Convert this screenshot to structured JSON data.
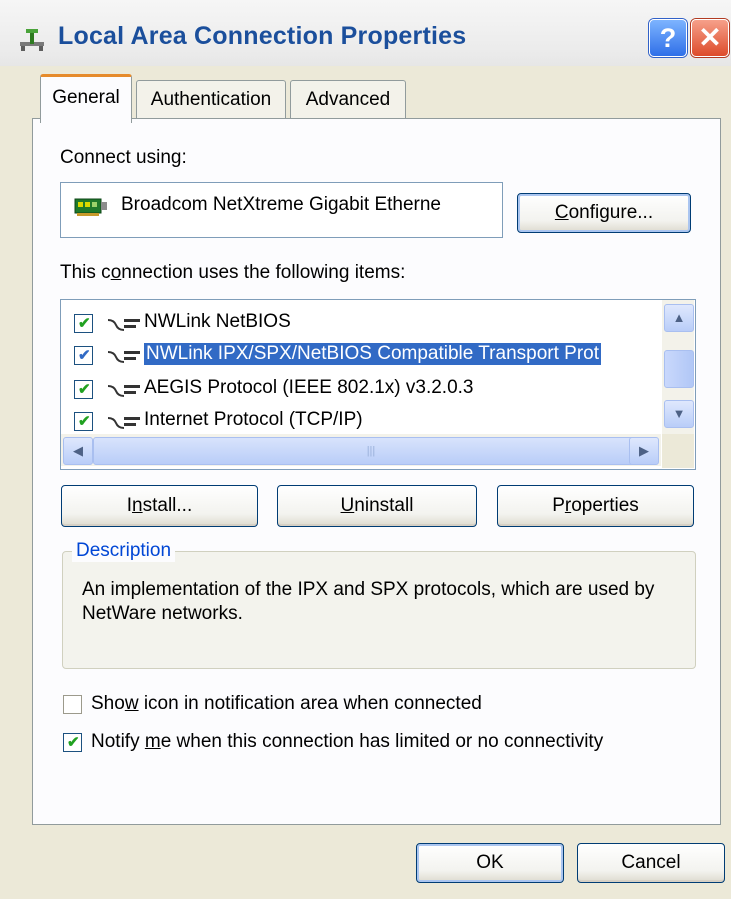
{
  "window": {
    "title": "Local Area Connection Properties",
    "help_glyph": "?",
    "close_glyph": "✕"
  },
  "tabs": [
    {
      "label": "General",
      "active": true
    },
    {
      "label": "Authentication",
      "active": false
    },
    {
      "label": "Advanced",
      "active": false
    }
  ],
  "general": {
    "connect_using_label": "Connect using:",
    "adapter_name": "Broadcom NetXtreme Gigabit Etherne",
    "configure_button": {
      "pre": "",
      "accel": "C",
      "post": "onfigure..."
    },
    "items_label": {
      "pre": "This c",
      "accel": "o",
      "post": "nnection uses the following items:"
    },
    "items": [
      {
        "label": "NWLink NetBIOS",
        "checked": true,
        "selected": false
      },
      {
        "label": "NWLink IPX/SPX/NetBIOS Compatible Transport Prot",
        "checked": true,
        "selected": true
      },
      {
        "label": "AEGIS Protocol (IEEE 802.1x) v3.2.0.3",
        "checked": true,
        "selected": false
      },
      {
        "label": "Internet Protocol (TCP/IP)",
        "checked": true,
        "selected": false
      }
    ],
    "install_button": {
      "pre": "I",
      "accel": "n",
      "post": "stall..."
    },
    "uninstall_button": {
      "pre": "",
      "accel": "U",
      "post": "ninstall"
    },
    "properties_button": {
      "pre": "P",
      "accel": "r",
      "post": "operties"
    },
    "description_legend": "Description",
    "description_text": "An implementation of the IPX and SPX protocols, which are used by NetWare networks.",
    "show_icon_option": {
      "pre": "Sho",
      "accel": "w",
      "post": " icon in notification area when connected",
      "checked": false
    },
    "notify_option": {
      "pre": "Notify ",
      "accel": "m",
      "post": "e when this connection has limited or no connectivity",
      "checked": true
    }
  },
  "footer": {
    "ok_label": "OK",
    "cancel_label": "Cancel"
  },
  "colors": {
    "title_text": "#1b4f9c",
    "selection": "#316ac5",
    "active_tab_accent": "#e68b2c",
    "description_legend": "#0046d5"
  },
  "icons": {
    "title": "network-connection-icon",
    "adapter": "network-card-icon",
    "protocol": "protocol-icon"
  }
}
